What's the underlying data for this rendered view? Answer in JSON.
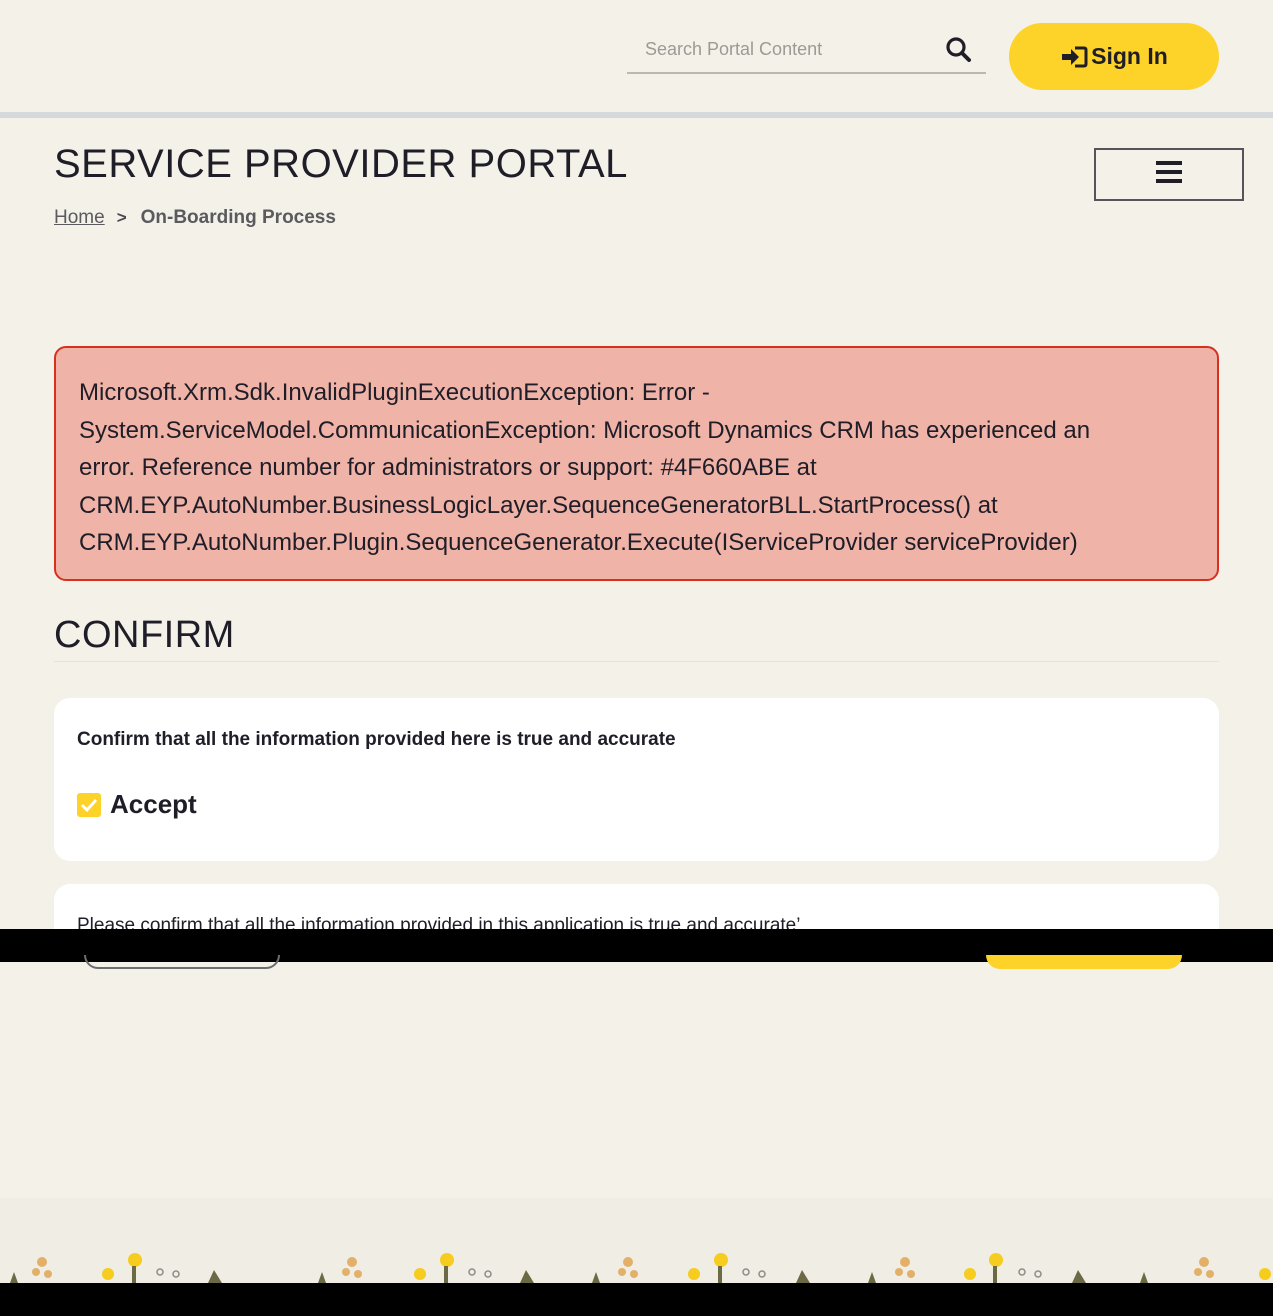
{
  "header": {
    "search": {
      "placeholder": "Search Portal Content",
      "value": ""
    },
    "search_icon": "search-icon",
    "signin": {
      "label": "Sign In",
      "icon": "sign-in-icon"
    }
  },
  "page": {
    "title": "SERVICE PROVIDER PORTAL",
    "menu_icon": "hamburger-menu-icon"
  },
  "breadcrumb": {
    "home": "Home",
    "separator": ">",
    "current": "On-Boarding Process"
  },
  "error": {
    "lines": [
      "Microsoft.Xrm.Sdk.InvalidPluginExecutionException: Error -",
      "System.ServiceModel.CommunicationException: Microsoft Dynamics CRM has experienced an",
      "error. Reference number for administrators or support: #4F660ABE at",
      "CRM.EYP.AutoNumber.BusinessLogicLayer.SequenceGeneratorBLL.StartProcess() at",
      "CRM.EYP.AutoNumber.Plugin.SequenceGenerator.Execute(IServiceProvider serviceProvider)"
    ]
  },
  "confirm": {
    "heading": "CONFIRM",
    "question": "Confirm that all the information provided here is true and accurate",
    "checkbox_label": "Accept",
    "checkbox_checked": true,
    "second_card_text": "Please confirm that all the information provided in this application is true and accurate’"
  },
  "colors": {
    "background": "#f3f1e8",
    "accent_yellow": "#fdd229",
    "error_bg": "#efb3a8",
    "error_border": "#d8301f",
    "text": "#1f1d27"
  }
}
